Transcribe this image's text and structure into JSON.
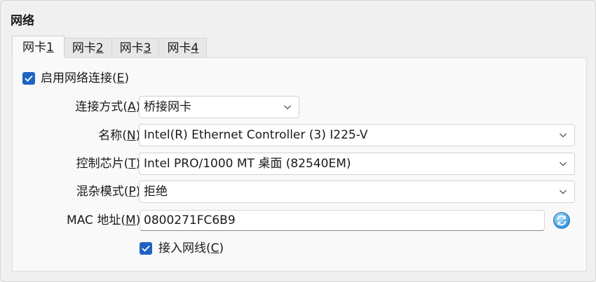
{
  "section_title": "网络",
  "tabs": [
    {
      "label": "网卡 ",
      "key": "1"
    },
    {
      "label": "网卡 ",
      "key": "2"
    },
    {
      "label": "网卡 ",
      "key": "3"
    },
    {
      "label": "网卡 ",
      "key": "4"
    }
  ],
  "enable": {
    "label": "启用网络连接(",
    "key": "E",
    "suffix": ")",
    "checked": true
  },
  "attached": {
    "label": "连接方式(",
    "key": "A",
    "suffix": "):",
    "value": "桥接网卡"
  },
  "name": {
    "label": "名称(",
    "key": "N",
    "suffix": "):",
    "value": "Intel(R) Ethernet Controller (3) I225-V"
  },
  "adapter": {
    "label": "控制芯片(",
    "key": "T",
    "suffix": "):",
    "value": "Intel PRO/1000 MT 桌面 (82540EM)"
  },
  "promisc": {
    "label": "混杂模式(",
    "key": "P",
    "suffix": "):",
    "value": "拒绝"
  },
  "mac": {
    "label": "MAC 地址(",
    "key": "M",
    "suffix": "):",
    "value": "0800271FC6B9"
  },
  "cable": {
    "label": "接入网线(",
    "key": "C",
    "suffix": ")",
    "checked": true
  },
  "colors": {
    "accent": "#1e63c4",
    "background": "#f0f0f0",
    "panel": "#f9f9f9"
  }
}
